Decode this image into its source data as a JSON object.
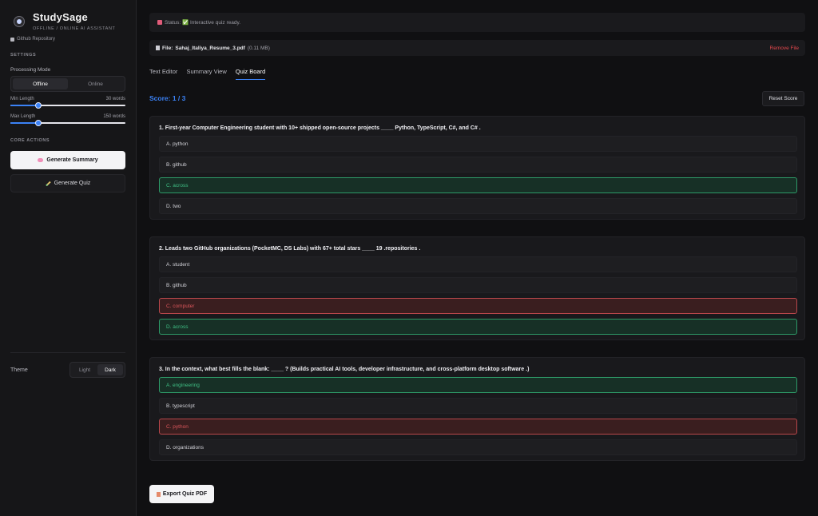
{
  "sidebar": {
    "brand_title": "StudySage",
    "brand_subtitle": "OFFLINE / ONLINE AI ASSISTANT",
    "repo_link": "Github Repository",
    "settings_heading": "SETTINGS",
    "processing_mode_label": "Processing Mode",
    "mode_offline": "Offline",
    "mode_online": "Online",
    "selected_mode": "Offline",
    "min_length_label": "Min Length",
    "min_length_value": "30 words",
    "min_length_fraction": 0.24,
    "max_length_label": "Max Length",
    "max_length_value": "150 words",
    "max_length_fraction": 0.24,
    "core_actions_heading": "CORE ACTIONS",
    "generate_summary": "Generate Summary",
    "generate_quiz": "Generate Quiz",
    "theme_label": "Theme",
    "theme_light": "Light",
    "theme_dark": "Dark",
    "selected_theme": "Dark"
  },
  "main": {
    "status_text": "Status: ✅ Interactive quiz ready.",
    "file_label": "File:",
    "file_name": "Sahaj_Italiya_Resume_3.pdf",
    "file_size": "(0.11 MB)",
    "remove_file": "Remove File",
    "tabs": [
      {
        "label": "Text Editor",
        "active": false
      },
      {
        "label": "Summary View",
        "active": false
      },
      {
        "label": "Quiz Board",
        "active": true
      }
    ],
    "score": "Score: 1 / 3",
    "reset_score": "Reset Score",
    "questions": [
      {
        "text": "1. First-year Computer Engineering student with 10+ shipped open-source projects ____ Python, TypeScript, C#, and C# .",
        "options": [
          {
            "label": "A. python",
            "state": "neutral"
          },
          {
            "label": "B. github",
            "state": "neutral"
          },
          {
            "label": "C. across",
            "state": "correct"
          },
          {
            "label": "D. two",
            "state": "neutral"
          }
        ]
      },
      {
        "text": "2. Leads two GitHub organizations (PocketMC, DS Labs) with 67+ total stars ____ 19 .repositories .",
        "options": [
          {
            "label": "A. student",
            "state": "neutral"
          },
          {
            "label": "B. github",
            "state": "neutral"
          },
          {
            "label": "C. computer",
            "state": "wrong"
          },
          {
            "label": "D. across",
            "state": "correct"
          }
        ]
      },
      {
        "text": "3. In the context, what best fills the blank: ____ ? (Builds practical AI tools, developer infrastructure, and cross-platform desktop software .)",
        "options": [
          {
            "label": "A. engineering",
            "state": "correct"
          },
          {
            "label": "B. typescript",
            "state": "neutral"
          },
          {
            "label": "C. python",
            "state": "wrong"
          },
          {
            "label": "D. organizations",
            "state": "neutral"
          }
        ]
      }
    ],
    "export_quiz_pdf": "Export Quiz PDF"
  },
  "colors": {
    "accent": "#3b82f6",
    "correct": "#3fbf84",
    "wrong": "#d9555a",
    "remove": "#e5484d"
  }
}
